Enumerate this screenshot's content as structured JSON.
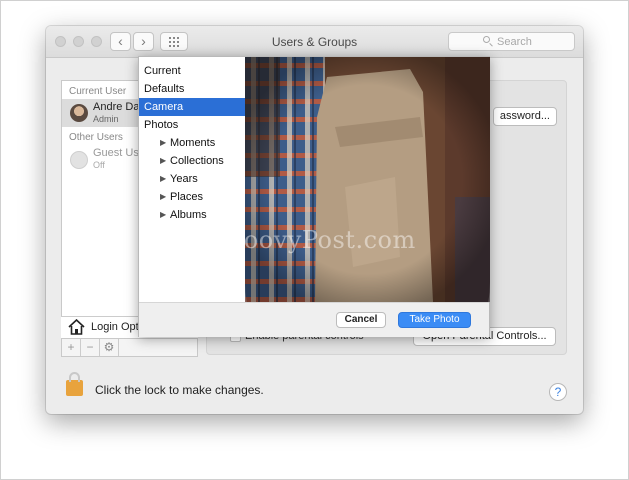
{
  "window": {
    "title": "Users & Groups"
  },
  "search": {
    "placeholder": "Search"
  },
  "sidebar": {
    "current_user_heading": "Current User",
    "current_user": {
      "name": "Andre Da",
      "role": "Admin"
    },
    "other_users_heading": "Other Users",
    "other_users": [
      {
        "name": "Guest Us",
        "status": "Off"
      }
    ],
    "login_options_label": "Login Opt",
    "add_symbol": "+",
    "remove_symbol": "−",
    "gear_symbol": "⚙"
  },
  "main": {
    "change_password_label": "assword...",
    "parental_controls_label": "Enable parental controls",
    "open_parental_label": "Open Parental Controls..."
  },
  "photo_picker": {
    "menu": [
      {
        "label": "Current",
        "level": 0,
        "selected": false
      },
      {
        "label": "Defaults",
        "level": 0,
        "selected": false
      },
      {
        "label": "Camera",
        "level": 0,
        "selected": true
      },
      {
        "label": "Photos",
        "level": 0,
        "selected": false
      },
      {
        "label": "Moments",
        "level": 1,
        "selected": false
      },
      {
        "label": "Collections",
        "level": 1,
        "selected": false
      },
      {
        "label": "Years",
        "level": 1,
        "selected": false
      },
      {
        "label": "Places",
        "level": 1,
        "selected": false
      },
      {
        "label": "Albums",
        "level": 1,
        "selected": false
      }
    ],
    "cancel_label": "Cancel",
    "take_photo_label": "Take Photo"
  },
  "footer": {
    "lock_text": "Click the lock to make changes.",
    "help_symbol": "?"
  },
  "watermark": "groovyPost.com",
  "colors": {
    "accent": "#2b6fd6",
    "take_photo": "#3b8cf5",
    "lock": "#e8a33d"
  }
}
